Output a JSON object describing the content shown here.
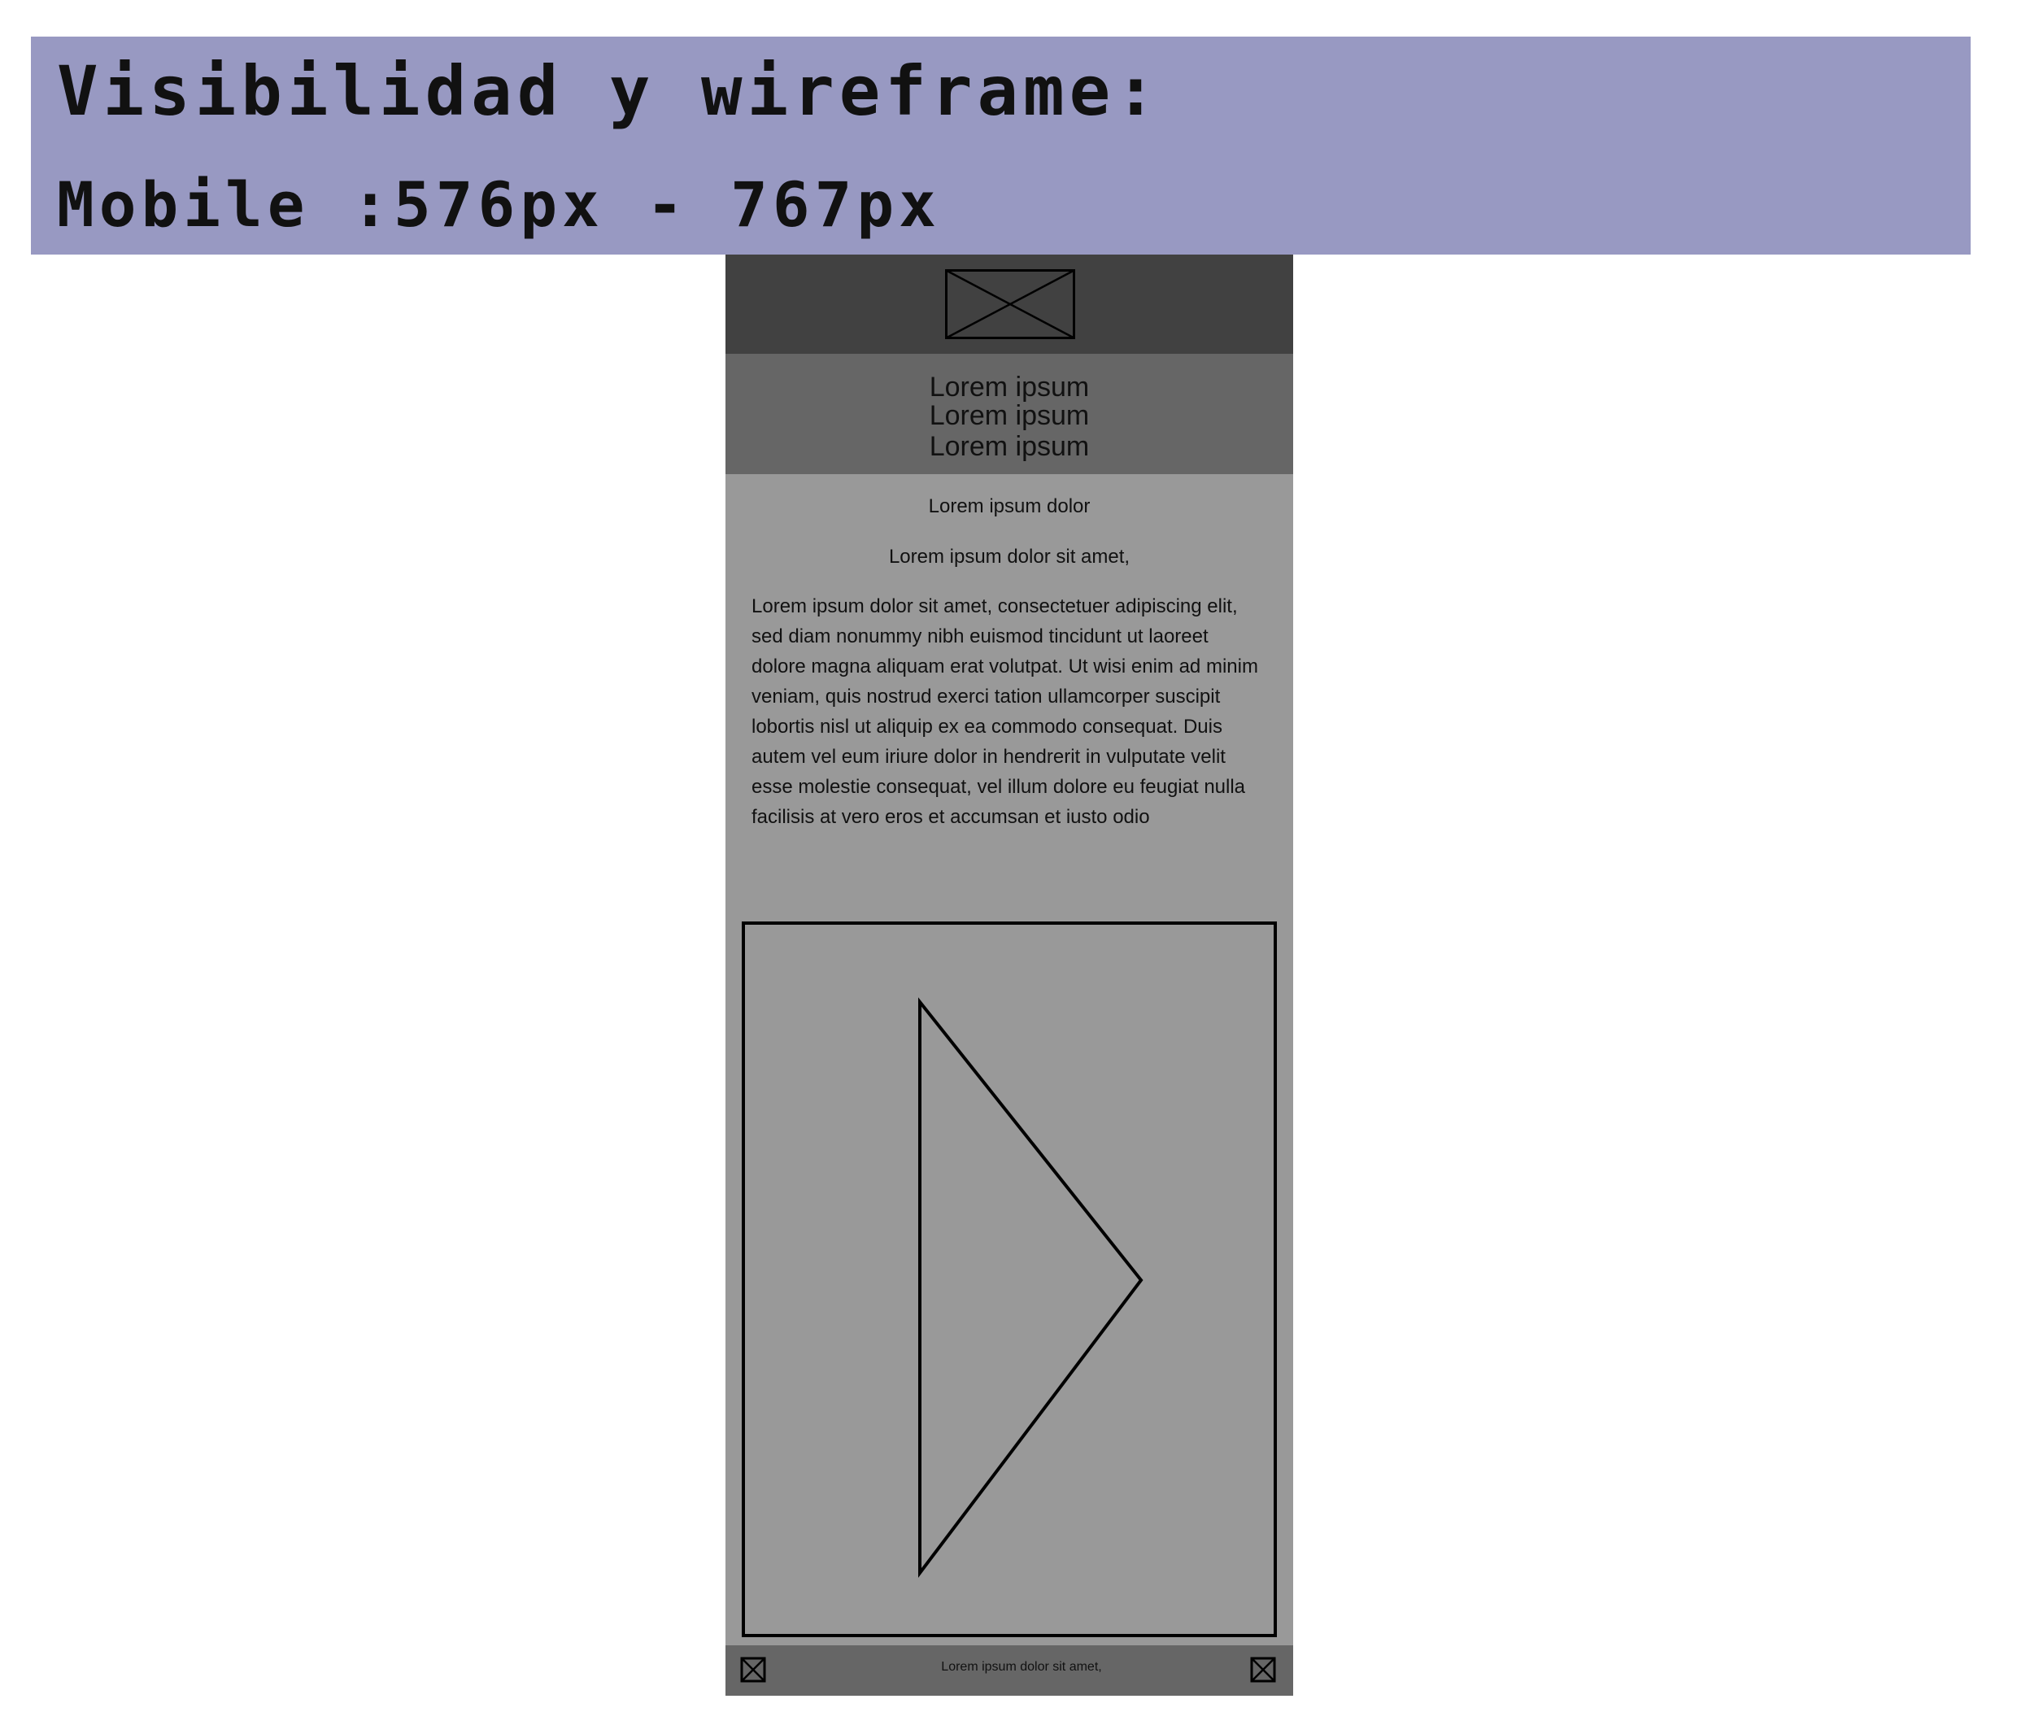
{
  "banner": {
    "title": "Visibilidad y wireframe:",
    "subtitle": "Mobile :576px - 767px",
    "background": "#9899c2"
  },
  "phone": {
    "header": {
      "logo_icon": "image-placeholder-icon",
      "background": "#414141"
    },
    "nav": {
      "items": [
        {
          "label": "Lorem ipsum"
        },
        {
          "label": "Lorem ipsum"
        },
        {
          "label": "Lorem ipsum"
        }
      ],
      "background": "#666666"
    },
    "content": {
      "title": "Lorem ipsum dolor",
      "subtitle": "Lorem ipsum dolor sit amet,",
      "body": "Lorem ipsum dolor sit amet, consectetuer adipiscing elit, sed diam nonummy nibh euismod tincidunt ut laoreet dolore magna aliquam erat volutpat. Ut wisi enim ad minim veniam, quis nostrud exerci tation ullamcorper suscipit lobortis nisl ut aliquip ex ea commodo consequat. Duis autem vel eum iriure dolor in hendrerit in vulputate velit esse molestie consequat, vel illum dolore eu feugiat nulla facilisis at vero eros et accumsan et iusto odio",
      "background": "#999999"
    },
    "video": {
      "icon": "play-icon"
    },
    "footer": {
      "text": "Lorem ipsum dolor sit amet,",
      "left_icon": "image-placeholder-icon",
      "right_icon": "image-placeholder-icon",
      "background": "#666666"
    }
  }
}
